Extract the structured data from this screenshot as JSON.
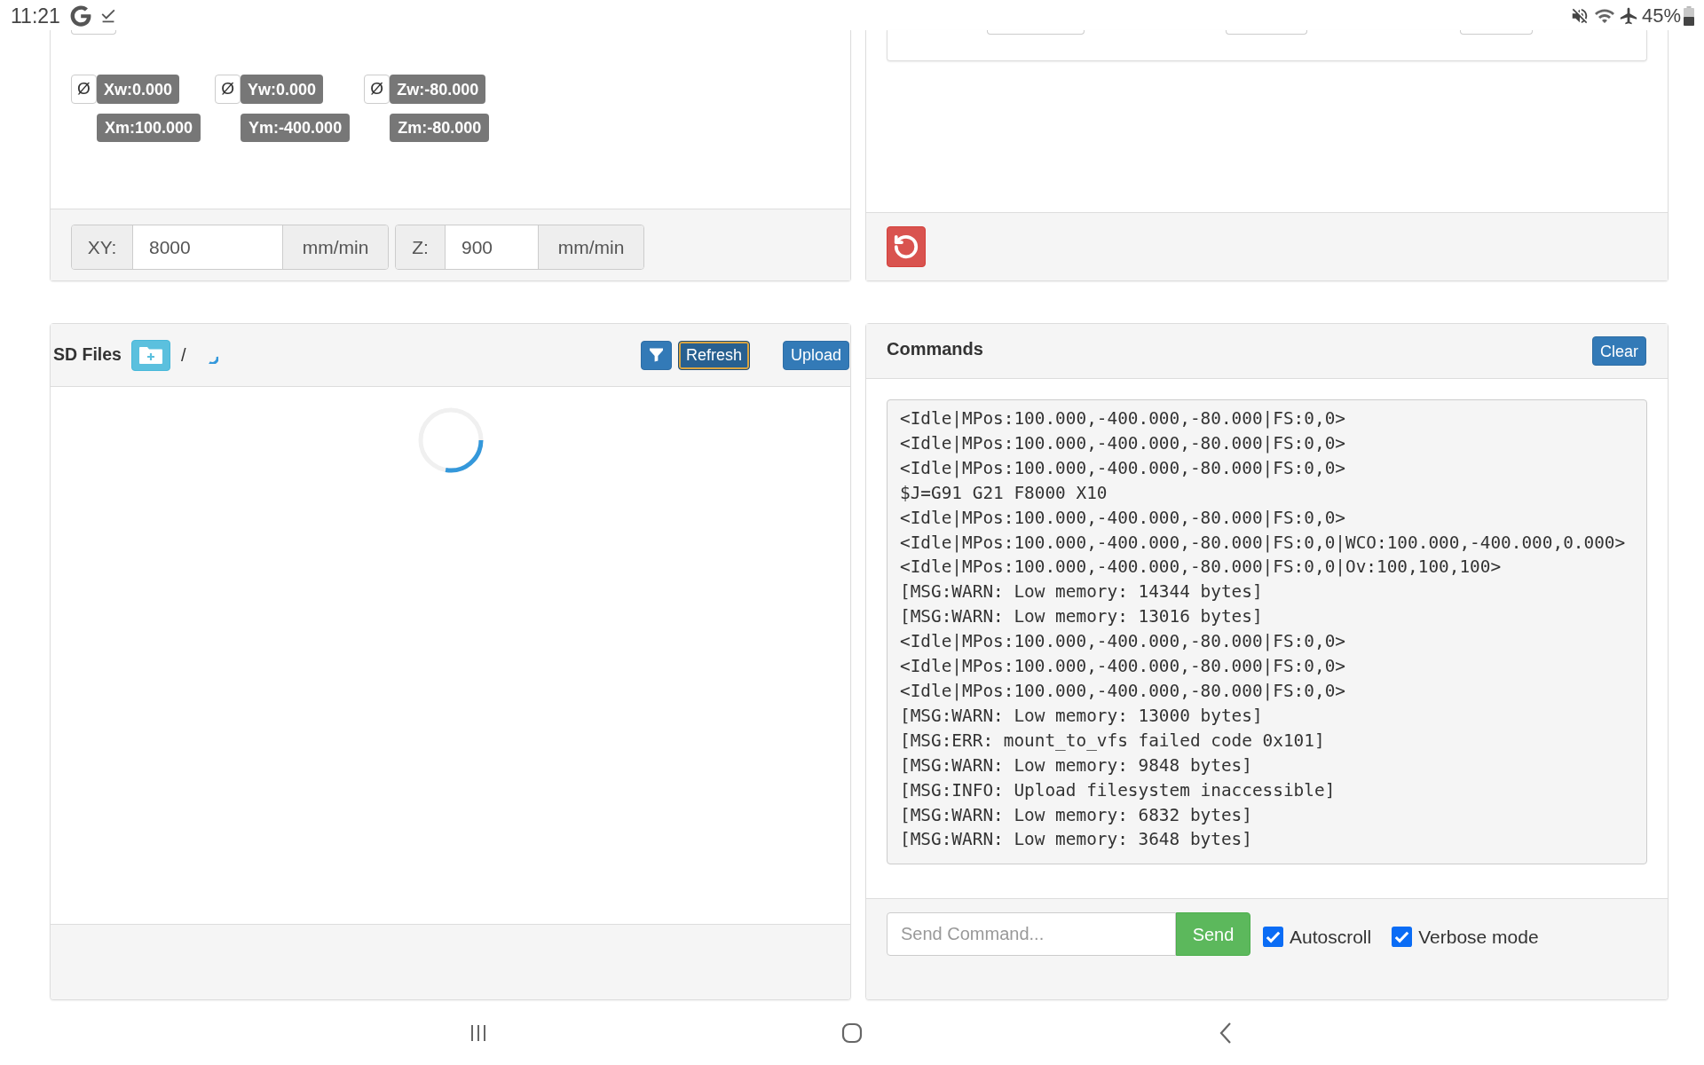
{
  "status_bar": {
    "time": "11:21",
    "battery": "45%"
  },
  "position": {
    "coordinates": [
      {
        "zero": "Ø",
        "work": "Xw:0.000",
        "machine": "Xm:100.000"
      },
      {
        "zero": "Ø",
        "work": "Yw:0.000",
        "machine": "Ym:-400.000"
      },
      {
        "zero": "Ø",
        "work": "Zw:-80.000",
        "machine": "Zm:-80.000"
      }
    ],
    "feed_rates": [
      {
        "label": "XY:",
        "value": "8000",
        "unit": "mm/min"
      },
      {
        "label": "Z:",
        "value": "900",
        "unit": "mm/min"
      }
    ]
  },
  "sd_files": {
    "title": "SD Files",
    "path": "/",
    "buttons": [
      {
        "kind": "filter",
        "focused": false
      },
      {
        "kind": "refresh",
        "label": "Refresh",
        "focused": true
      },
      {
        "kind": "upload",
        "label": "Upload",
        "focused": false
      }
    ]
  },
  "commands": {
    "title": "Commands",
    "clear": "Clear",
    "log": [
      "<Idle|MPos:100.000,-400.000,-80.000|FS:0,0>",
      "<Idle|MPos:100.000,-400.000,-80.000|FS:0,0>",
      "<Idle|MPos:100.000,-400.000,-80.000|FS:0,0>",
      "$J=G91 G21 F8000 X10",
      "<Idle|MPos:100.000,-400.000,-80.000|FS:0,0>",
      "<Idle|MPos:100.000,-400.000,-80.000|FS:0,0|WCO:100.000,-400.000,0.000>",
      "<Idle|MPos:100.000,-400.000,-80.000|FS:0,0|Ov:100,100,100>",
      "[MSG:WARN: Low memory: 14344 bytes]",
      "[MSG:WARN: Low memory: 13016 bytes]",
      "<Idle|MPos:100.000,-400.000,-80.000|FS:0,0>",
      "<Idle|MPos:100.000,-400.000,-80.000|FS:0,0>",
      "<Idle|MPos:100.000,-400.000,-80.000|FS:0,0>",
      "[MSG:WARN: Low memory: 13000 bytes]",
      "[MSG:ERR: mount_to_vfs failed code 0x101]",
      "[MSG:WARN: Low memory: 9848 bytes]",
      "[MSG:INFO: Upload filesystem inaccessible]",
      "[MSG:WARN: Low memory: 6832 bytes]",
      "[MSG:WARN: Low memory: 3648 bytes]"
    ],
    "input": {
      "placeholder": "Send Command..."
    },
    "send": "Send",
    "options": [
      {
        "label": "Autoscroll",
        "checked": true
      },
      {
        "label": "Verbose mode",
        "checked": true
      }
    ]
  }
}
